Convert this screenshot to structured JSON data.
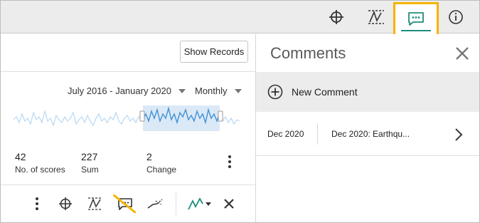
{
  "toolbar": {
    "icons": [
      "crosshair-icon",
      "trend-lines-icon",
      "comments-icon",
      "info-icon"
    ],
    "active": "comments-icon",
    "accent_color": "#1e8d7d",
    "highlight_color": "#f5b400"
  },
  "left_panel": {
    "show_records_label": "Show Records",
    "date_range": "July 2016 - January 2020",
    "period": "Monthly",
    "kpis": [
      {
        "value": "42",
        "label": "No. of scores"
      },
      {
        "value": "227",
        "label": "Sum"
      },
      {
        "value": "2",
        "label": "Change"
      }
    ],
    "bottom_icons": [
      "more-vertical-icon",
      "crosshair-icon",
      "trend-lines-icon",
      "comments-off-icon",
      "forecast-icon",
      "chart-type-icon",
      "close-icon"
    ]
  },
  "comments_panel": {
    "title": "Comments",
    "new_comment_label": "New Comment",
    "items": [
      {
        "date": "Dec 2020",
        "title": "Dec 2020: Earthqu..."
      }
    ]
  }
}
